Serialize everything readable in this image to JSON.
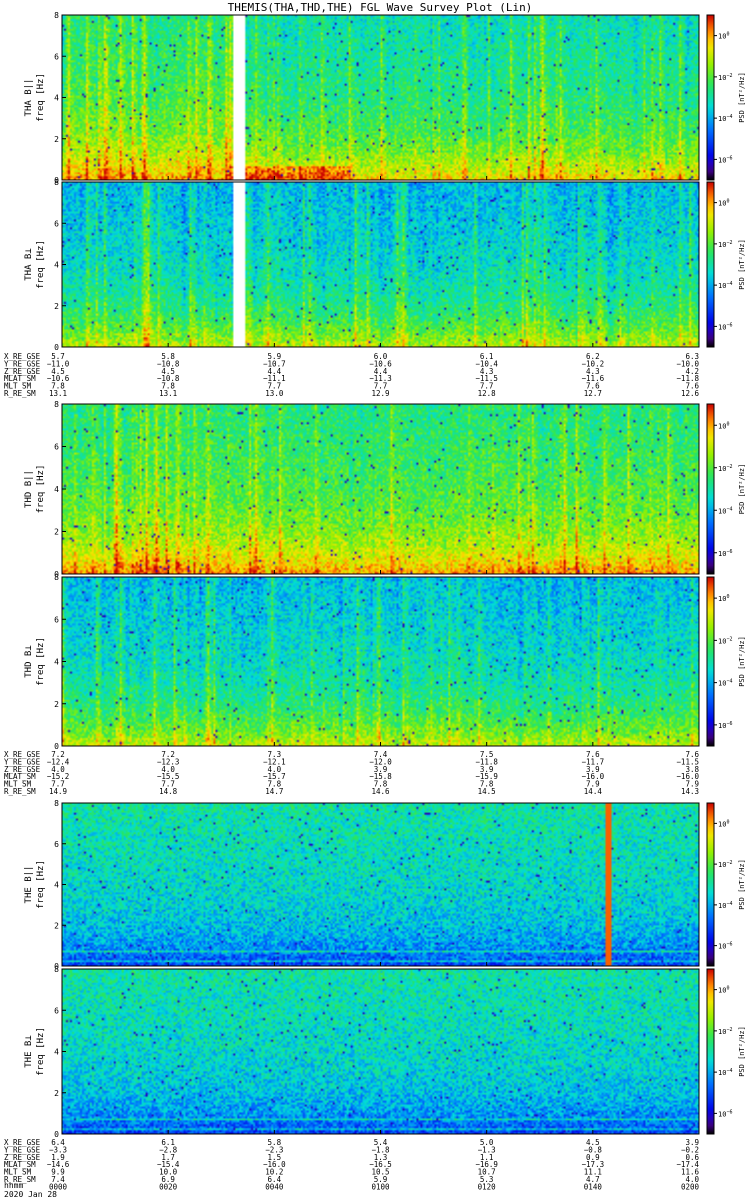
{
  "title": "THEMIS(THA,THD,THE) FGL Wave Survey Plot (Lin)",
  "footer": {
    "time_label": "hhmm",
    "date_label": "2020 Jan 28"
  },
  "colorbar": {
    "label": "PSD [nT²/Hz]",
    "ticks": [
      {
        "exponent": "0",
        "value": 1
      },
      {
        "exponent": "−2",
        "value": 0.01
      },
      {
        "exponent": "−4",
        "value": 0.0001
      },
      {
        "exponent": "−6",
        "value": 1e-06
      }
    ],
    "range": [
      1e-07,
      10
    ]
  },
  "time_ticks": [
    "0000",
    "0020",
    "0040",
    "0100",
    "0120",
    "0140",
    "0200"
  ],
  "chart_data": [
    {
      "type": "heatmap",
      "panel": "THA B||",
      "ylabel": "THA B||",
      "ylabel2": "freq [Hz]",
      "ylim": [
        0,
        8
      ],
      "yticks": [
        0,
        2,
        4,
        6,
        8
      ],
      "x_range": [
        "0000",
        "0200"
      ],
      "data_gap": [
        "0032",
        "0034"
      ],
      "color_scale": "log",
      "z_label": "PSD [nT²/Hz]",
      "z_range": [
        1e-07,
        10
      ],
      "level": "high",
      "features": "Broadband enhancements below 1 Hz, quieter after 0040 with narrow low-frequency band"
    },
    {
      "type": "heatmap",
      "panel": "THA B⊥",
      "ylabel": "THA B⊥",
      "ylabel2": "freq [Hz]",
      "ylim": [
        0,
        8
      ],
      "yticks": [
        0,
        2,
        4,
        6,
        8
      ],
      "x_range": [
        "0000",
        "0200"
      ],
      "data_gap": [
        "0032",
        "0034"
      ],
      "color_scale": "log",
      "z_label": "PSD [nT²/Hz]",
      "z_range": [
        1e-07,
        10
      ],
      "level": "mid"
    },
    {
      "type": "heatmap",
      "panel": "THD B||",
      "ylabel": "THD B||",
      "ylabel2": "freq [Hz]",
      "ylim": [
        0,
        8
      ],
      "yticks": [
        0,
        2,
        4,
        6,
        8
      ],
      "x_range": [
        "0000",
        "0200"
      ],
      "color_scale": "log",
      "z_label": "PSD [nT²/Hz]",
      "z_range": [
        1e-07,
        10
      ],
      "level": "high"
    },
    {
      "type": "heatmap",
      "panel": "THD B⊥",
      "ylabel": "THD B⊥",
      "ylabel2": "freq [Hz]",
      "ylim": [
        0,
        8
      ],
      "yticks": [
        0,
        2,
        4,
        6,
        8
      ],
      "x_range": [
        "0000",
        "0200"
      ],
      "color_scale": "log",
      "z_label": "PSD [nT²/Hz]",
      "z_range": [
        1e-07,
        10
      ],
      "level": "mid"
    },
    {
      "type": "heatmap",
      "panel": "THE B||",
      "ylabel": "THE B||",
      "ylabel2": "freq [Hz]",
      "ylim": [
        0,
        8
      ],
      "yticks": [
        0,
        2,
        4,
        6,
        8
      ],
      "x_range": [
        "0000",
        "0200"
      ],
      "color_scale": "log",
      "z_label": "PSD [nT²/Hz]",
      "z_range": [
        1e-07,
        10
      ],
      "level": "low",
      "spike_time": "0143"
    },
    {
      "type": "heatmap",
      "panel": "THE B⊥",
      "ylabel": "THE B⊥",
      "ylabel2": "freq [Hz]",
      "ylim": [
        0,
        8
      ],
      "yticks": [
        0,
        2,
        4,
        6,
        8
      ],
      "x_range": [
        "0000",
        "0200"
      ],
      "color_scale": "log",
      "z_label": "PSD [nT²/Hz]",
      "z_range": [
        1e-07,
        10
      ],
      "level": "low"
    }
  ],
  "ephemeris": [
    {
      "probe": "THA",
      "rows": [
        {
          "label": "X_RE_GSE",
          "values": [
            "5.7",
            "5.8",
            "5.9",
            "6.0",
            "6.1",
            "6.2",
            "6.3"
          ]
        },
        {
          "label": "Y_RE_GSE",
          "values": [
            "−11.0",
            "−10.8",
            "−10.7",
            "−10.6",
            "−10.4",
            "−10.2",
            "−10.0"
          ]
        },
        {
          "label": "Z_RE_GSE",
          "values": [
            "4.5",
            "4.5",
            "4.4",
            "4.4",
            "4.3",
            "4.3",
            "4.2"
          ]
        },
        {
          "label": "MLAT_SM",
          "values": [
            "−10.6",
            "−10.8",
            "−11.1",
            "−11.3",
            "−11.5",
            "−11.6",
            "−11.8"
          ]
        },
        {
          "label": "MLT_SM",
          "values": [
            "7.8",
            "7.8",
            "7.7",
            "7.7",
            "7.7",
            "7.6",
            "7.6"
          ]
        },
        {
          "label": "R_RE_SM",
          "values": [
            "13.1",
            "13.1",
            "13.0",
            "12.9",
            "12.8",
            "12.7",
            "12.6"
          ]
        }
      ]
    },
    {
      "probe": "THD",
      "rows": [
        {
          "label": "X_RE_GSE",
          "values": [
            "7.2",
            "7.2",
            "7.3",
            "7.4",
            "7.5",
            "7.6",
            "7.6"
          ]
        },
        {
          "label": "Y_RE_GSE",
          "values": [
            "−12.4",
            "−12.3",
            "−12.1",
            "−12.0",
            "−11.8",
            "−11.7",
            "−11.5"
          ]
        },
        {
          "label": "Z_RE_GSE",
          "values": [
            "4.0",
            "4.0",
            "4.0",
            "3.9",
            "3.9",
            "3.9",
            "3.8"
          ]
        },
        {
          "label": "MLAT_SM",
          "values": [
            "−15.2",
            "−15.5",
            "−15.7",
            "−15.8",
            "−15.9",
            "−16.0",
            "−16.0"
          ]
        },
        {
          "label": "MLT_SM",
          "values": [
            "7.7",
            "7.7",
            "7.8",
            "7.8",
            "7.8",
            "7.9",
            "7.9"
          ]
        },
        {
          "label": "R_RE_SM",
          "values": [
            "14.9",
            "14.8",
            "14.7",
            "14.6",
            "14.5",
            "14.4",
            "14.3"
          ]
        }
      ]
    },
    {
      "probe": "THE",
      "rows": [
        {
          "label": "X_RE_GSE",
          "values": [
            "6.4",
            "6.1",
            "5.8",
            "5.4",
            "5.0",
            "4.5",
            "3.9"
          ]
        },
        {
          "label": "Y_RE_GSE",
          "values": [
            "−3.3",
            "−2.8",
            "−2.3",
            "−1.8",
            "−1.3",
            "−0.8",
            "−0.2"
          ]
        },
        {
          "label": "Z_RE_GSE",
          "values": [
            "1.9",
            "1.7",
            "1.5",
            "1.3",
            "1.1",
            "0.9",
            "0.6"
          ]
        },
        {
          "label": "MLAT_SM",
          "values": [
            "−14.6",
            "−15.4",
            "−16.0",
            "−16.5",
            "−16.9",
            "−17.3",
            "−17.4"
          ]
        },
        {
          "label": "MLT_SM",
          "values": [
            "9.9",
            "10.0",
            "10.2",
            "10.5",
            "10.7",
            "11.1",
            "11.6"
          ]
        },
        {
          "label": "R_RE_SM",
          "values": [
            "7.4",
            "6.9",
            "6.4",
            "5.9",
            "5.3",
            "4.7",
            "4.0"
          ]
        }
      ]
    }
  ]
}
